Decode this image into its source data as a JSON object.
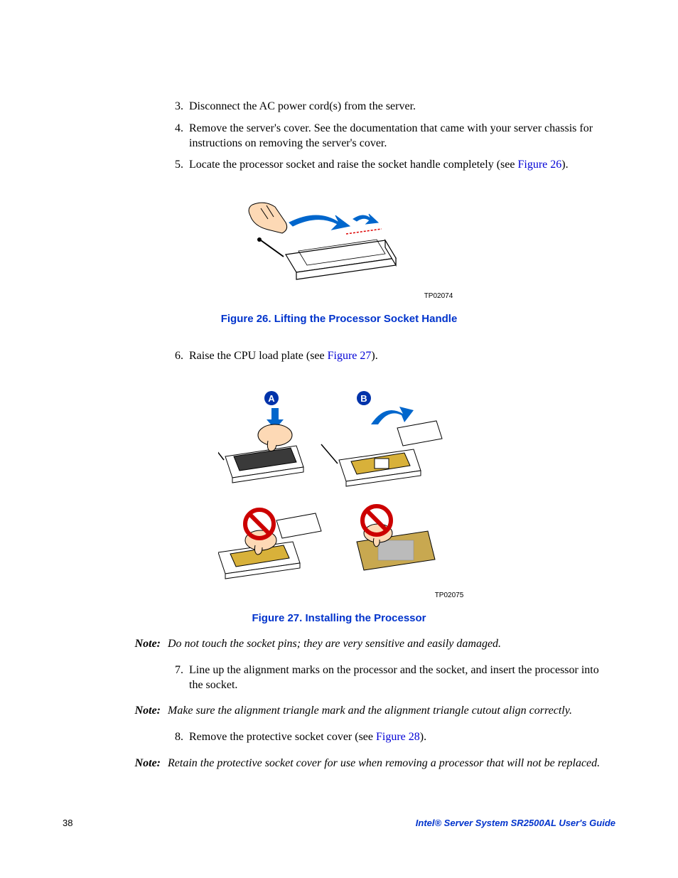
{
  "steps": {
    "s3": {
      "num": "3.",
      "text": "Disconnect the AC power cord(s) from the server."
    },
    "s4": {
      "num": "4.",
      "text": "Remove the server's cover. See the documentation that came with your server chassis for instructions on removing the server's cover."
    },
    "s5": {
      "num": "5.",
      "pre": "Locate the processor socket and raise the socket handle completely (see ",
      "link": "Figure 26",
      "post": ")."
    },
    "s6": {
      "num": "6.",
      "pre": "Raise the CPU load plate (see ",
      "link": "Figure 27",
      "post": ")."
    },
    "s7": {
      "num": "7.",
      "text": "Line up the alignment marks on the processor and the socket, and insert the processor into the socket."
    },
    "s8": {
      "num": "8.",
      "pre": "Remove the protective socket cover (see ",
      "link": "Figure 28",
      "post": ")."
    }
  },
  "figures": {
    "f26": {
      "tp": "TP02074",
      "caption": "Figure 26. Lifting the Processor Socket Handle"
    },
    "f27": {
      "tp": "TP02075",
      "caption": "Figure 27. Installing the Processor",
      "labelA": "A",
      "labelB": "B"
    }
  },
  "notes": {
    "label": "Note:",
    "n1": "Do not touch the socket pins; they are very sensitive and easily damaged.",
    "n2": "Make sure the alignment triangle mark and the alignment triangle cutout align correctly.",
    "n3": "Retain the protective socket cover for use when removing a processor that will not be replaced."
  },
  "footer": {
    "page": "38",
    "title": "Intel® Server System SR2500AL User's Guide"
  }
}
